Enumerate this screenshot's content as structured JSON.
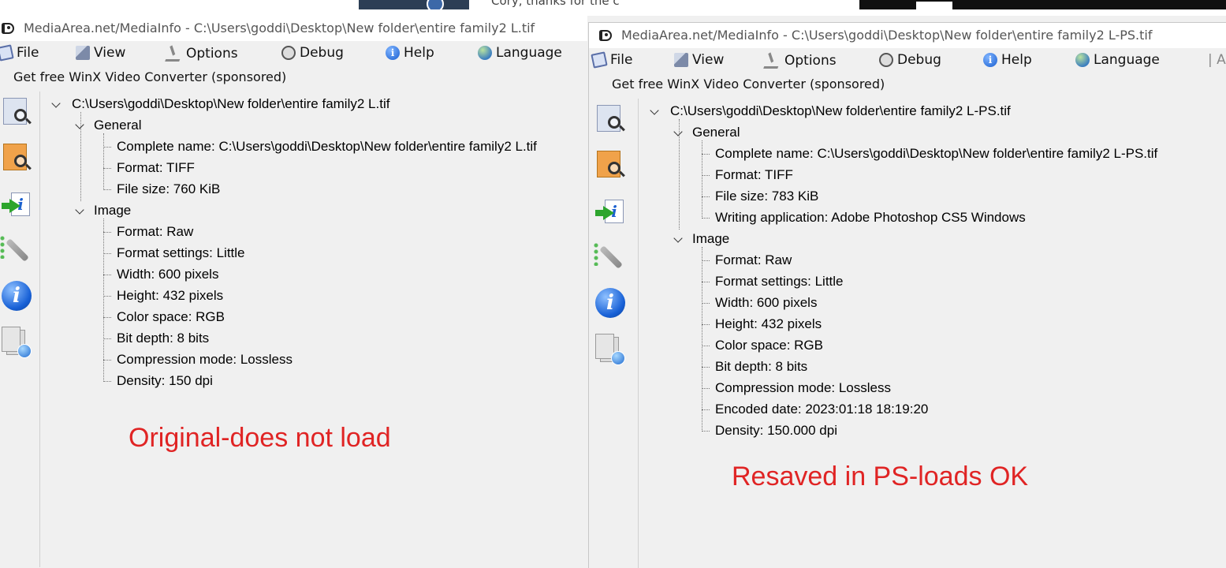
{
  "left_window": {
    "title": "MediaArea.net/MediaInfo - C:\\Users\\goddi\\Desktop\\New folder\\entire family2 L.tif",
    "menu": [
      "File",
      "View",
      "Options",
      "Debug",
      "Help",
      "Language"
    ],
    "sponsor": "Get free WinX Video Converter (sponsored)",
    "tree": {
      "file_path": "C:\\Users\\goddi\\Desktop\\New folder\\entire family2 L.tif",
      "general_label": "General",
      "general_items": [
        "Complete name: C:\\Users\\goddi\\Desktop\\New folder\\entire family2 L.tif",
        "Format: TIFF",
        "File size: 760 KiB"
      ],
      "image_label": "Image",
      "image_items": [
        "Format: Raw",
        "Format settings: Little",
        "Width: 600 pixels",
        "Height: 432 pixels",
        "Color space: RGB",
        "Bit depth: 8 bits",
        "Compression mode: Lossless",
        "Density: 150 dpi"
      ]
    },
    "annotation": "Original-does not load"
  },
  "right_window": {
    "title": "MediaArea.net/MediaInfo - C:\\Users\\goddi\\Desktop\\New folder\\entire family2 L-PS.tif",
    "menu": [
      "File",
      "View",
      "Options",
      "Debug",
      "Help",
      "Language"
    ],
    "menu_overflow": "| A",
    "sponsor": "Get free WinX Video Converter (sponsored)",
    "tree": {
      "file_path": "C:\\Users\\goddi\\Desktop\\New folder\\entire family2 L-PS.tif",
      "general_label": "General",
      "general_items": [
        "Complete name: C:\\Users\\goddi\\Desktop\\New folder\\entire family2 L-PS.tif",
        "Format: TIFF",
        "File size: 783 KiB",
        "Writing application: Adobe Photoshop CS5 Windows"
      ],
      "image_label": "Image",
      "image_items": [
        "Format: Raw",
        "Format settings: Little",
        "Width: 600 pixels",
        "Height: 432 pixels",
        "Color space: RGB",
        "Bit depth: 8 bits",
        "Compression mode: Lossless",
        "Encoded date: 2023:01:18 18:19:20",
        "Density: 150.000 dpi"
      ]
    },
    "annotation": "Resaved in PS-loads OK"
  },
  "background": {
    "partial_text": "Cory, thanks for the c"
  },
  "colors": {
    "annotation": "#e02424",
    "window_bg": "#f0f0f0",
    "title_text": "#555555"
  },
  "icons": {
    "toolbar": [
      "easy-view-icon",
      "sheet-view-icon",
      "export-icon",
      "preferences-icon",
      "about-icon",
      "check-update-icon"
    ],
    "menu": [
      "file-icon",
      "view-icon",
      "options-icon",
      "debug-icon",
      "help-icon",
      "language-icon"
    ]
  }
}
